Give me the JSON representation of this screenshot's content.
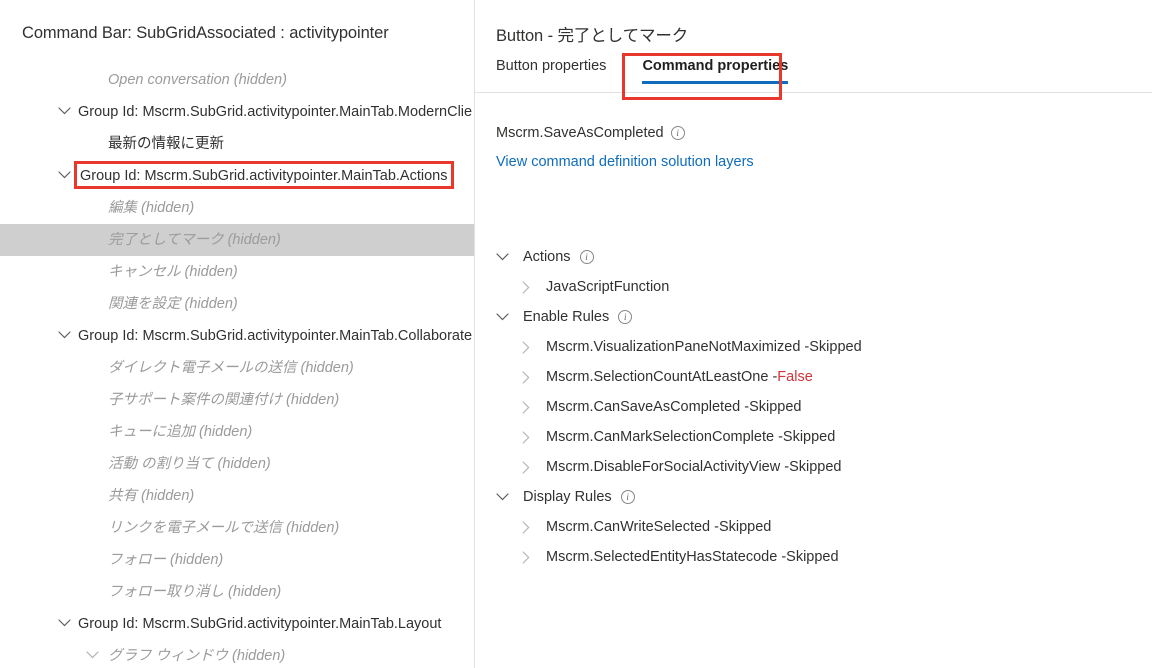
{
  "left": {
    "title": "Command Bar: SubGridAssociated : activitypointer",
    "tree": [
      {
        "kind": "item",
        "indent": 108,
        "text": "Open conversation",
        "suffix": " (hidden)",
        "chevron": false,
        "selected": false
      },
      {
        "kind": "group",
        "indent": 78,
        "text": "Group Id: Mscrm.SubGrid.activitypointer.MainTab.ModernClie",
        "suffix": "",
        "chevron": true,
        "chevronX": 58,
        "selected": false
      },
      {
        "kind": "plain",
        "indent": 108,
        "text": "最新の情報に更新",
        "suffix": "",
        "chevron": false,
        "selected": false
      },
      {
        "kind": "group",
        "indent": 80,
        "text": "Group Id: Mscrm.SubGrid.activitypointer.MainTab.Actions",
        "suffix": "",
        "chevron": true,
        "chevronX": 58,
        "selected": false
      },
      {
        "kind": "item",
        "indent": 108,
        "text": "編集",
        "suffix": " (hidden)",
        "chevron": false,
        "selected": false
      },
      {
        "kind": "item",
        "indent": 108,
        "text": "完了としてマーク",
        "suffix": " (hidden)",
        "chevron": false,
        "selected": true
      },
      {
        "kind": "item",
        "indent": 108,
        "text": "キャンセル",
        "suffix": " (hidden)",
        "chevron": false,
        "selected": false
      },
      {
        "kind": "item",
        "indent": 108,
        "text": "関連を設定",
        "suffix": " (hidden)",
        "chevron": false,
        "selected": false
      },
      {
        "kind": "group",
        "indent": 78,
        "text": "Group Id: Mscrm.SubGrid.activitypointer.MainTab.Collaborate",
        "suffix": "",
        "chevron": true,
        "chevronX": 58,
        "selected": false
      },
      {
        "kind": "item",
        "indent": 108,
        "text": "ダイレクト電子メールの送信",
        "suffix": " (hidden)",
        "chevron": false,
        "selected": false
      },
      {
        "kind": "item",
        "indent": 108,
        "text": "子サポート案件の関連付け",
        "suffix": " (hidden)",
        "chevron": false,
        "selected": false
      },
      {
        "kind": "item",
        "indent": 108,
        "text": "キューに追加",
        "suffix": " (hidden)",
        "chevron": false,
        "selected": false
      },
      {
        "kind": "item",
        "indent": 108,
        "text": "活動 の割り当て",
        "suffix": " (hidden)",
        "chevron": false,
        "selected": false
      },
      {
        "kind": "item",
        "indent": 108,
        "text": "共有",
        "suffix": " (hidden)",
        "chevron": false,
        "selected": false
      },
      {
        "kind": "item",
        "indent": 108,
        "text": "リンクを電子メールで送信",
        "suffix": " (hidden)",
        "chevron": false,
        "selected": false
      },
      {
        "kind": "item",
        "indent": 108,
        "text": "フォロー",
        "suffix": " (hidden)",
        "chevron": false,
        "selected": false
      },
      {
        "kind": "item",
        "indent": 108,
        "text": "フォロー取り消し",
        "suffix": " (hidden)",
        "chevron": false,
        "selected": false
      },
      {
        "kind": "group",
        "indent": 78,
        "text": "Group Id: Mscrm.SubGrid.activitypointer.MainTab.Layout",
        "suffix": "",
        "chevron": true,
        "chevronX": 58,
        "selected": false
      },
      {
        "kind": "item",
        "indent": 108,
        "text": "グラフ ウィンドウ",
        "suffix": " (hidden)",
        "chevron": true,
        "chevronX": 86,
        "selected": false
      }
    ]
  },
  "right": {
    "title": "Button - 完了としてマーク",
    "tabs": [
      {
        "label": "Button properties",
        "active": false
      },
      {
        "label": "Command properties",
        "active": true
      }
    ],
    "command_name": "Mscrm.SaveAsCompleted",
    "info_glyph": "i",
    "solution_layers_link": "View command definition solution layers",
    "sections": [
      {
        "title": "Actions",
        "has_info": true,
        "items": [
          {
            "text": "JavaScriptFunction",
            "status": "",
            "status_color": ""
          }
        ]
      },
      {
        "title": "Enable Rules",
        "has_info": true,
        "items": [
          {
            "text": "Mscrm.VisualizationPaneNotMaximized - ",
            "status": "Skipped",
            "status_color": "#323130"
          },
          {
            "text": "Mscrm.SelectionCountAtLeastOne - ",
            "status": "False",
            "status_color": "#d13438"
          },
          {
            "text": "Mscrm.CanSaveAsCompleted - ",
            "status": "Skipped",
            "status_color": "#323130"
          },
          {
            "text": "Mscrm.CanMarkSelectionComplete - ",
            "status": "Skipped",
            "status_color": "#323130"
          },
          {
            "text": "Mscrm.DisableForSocialActivityView - ",
            "status": "Skipped",
            "status_color": "#323130"
          }
        ]
      },
      {
        "title": "Display Rules",
        "has_info": true,
        "items": [
          {
            "text": "Mscrm.CanWriteSelected - ",
            "status": "Skipped",
            "status_color": "#323130"
          },
          {
            "text": "Mscrm.SelectedEntityHasStatecode - ",
            "status": "Skipped",
            "status_color": "#323130"
          }
        ]
      }
    ]
  },
  "theme": {
    "accent": "#0f6cbd",
    "highlight_box": "#e8382c",
    "selected_row_bg": "#cfcfcf",
    "hidden_text": "#9b9b9b",
    "text": "#323130",
    "false_red": "#d13438"
  }
}
